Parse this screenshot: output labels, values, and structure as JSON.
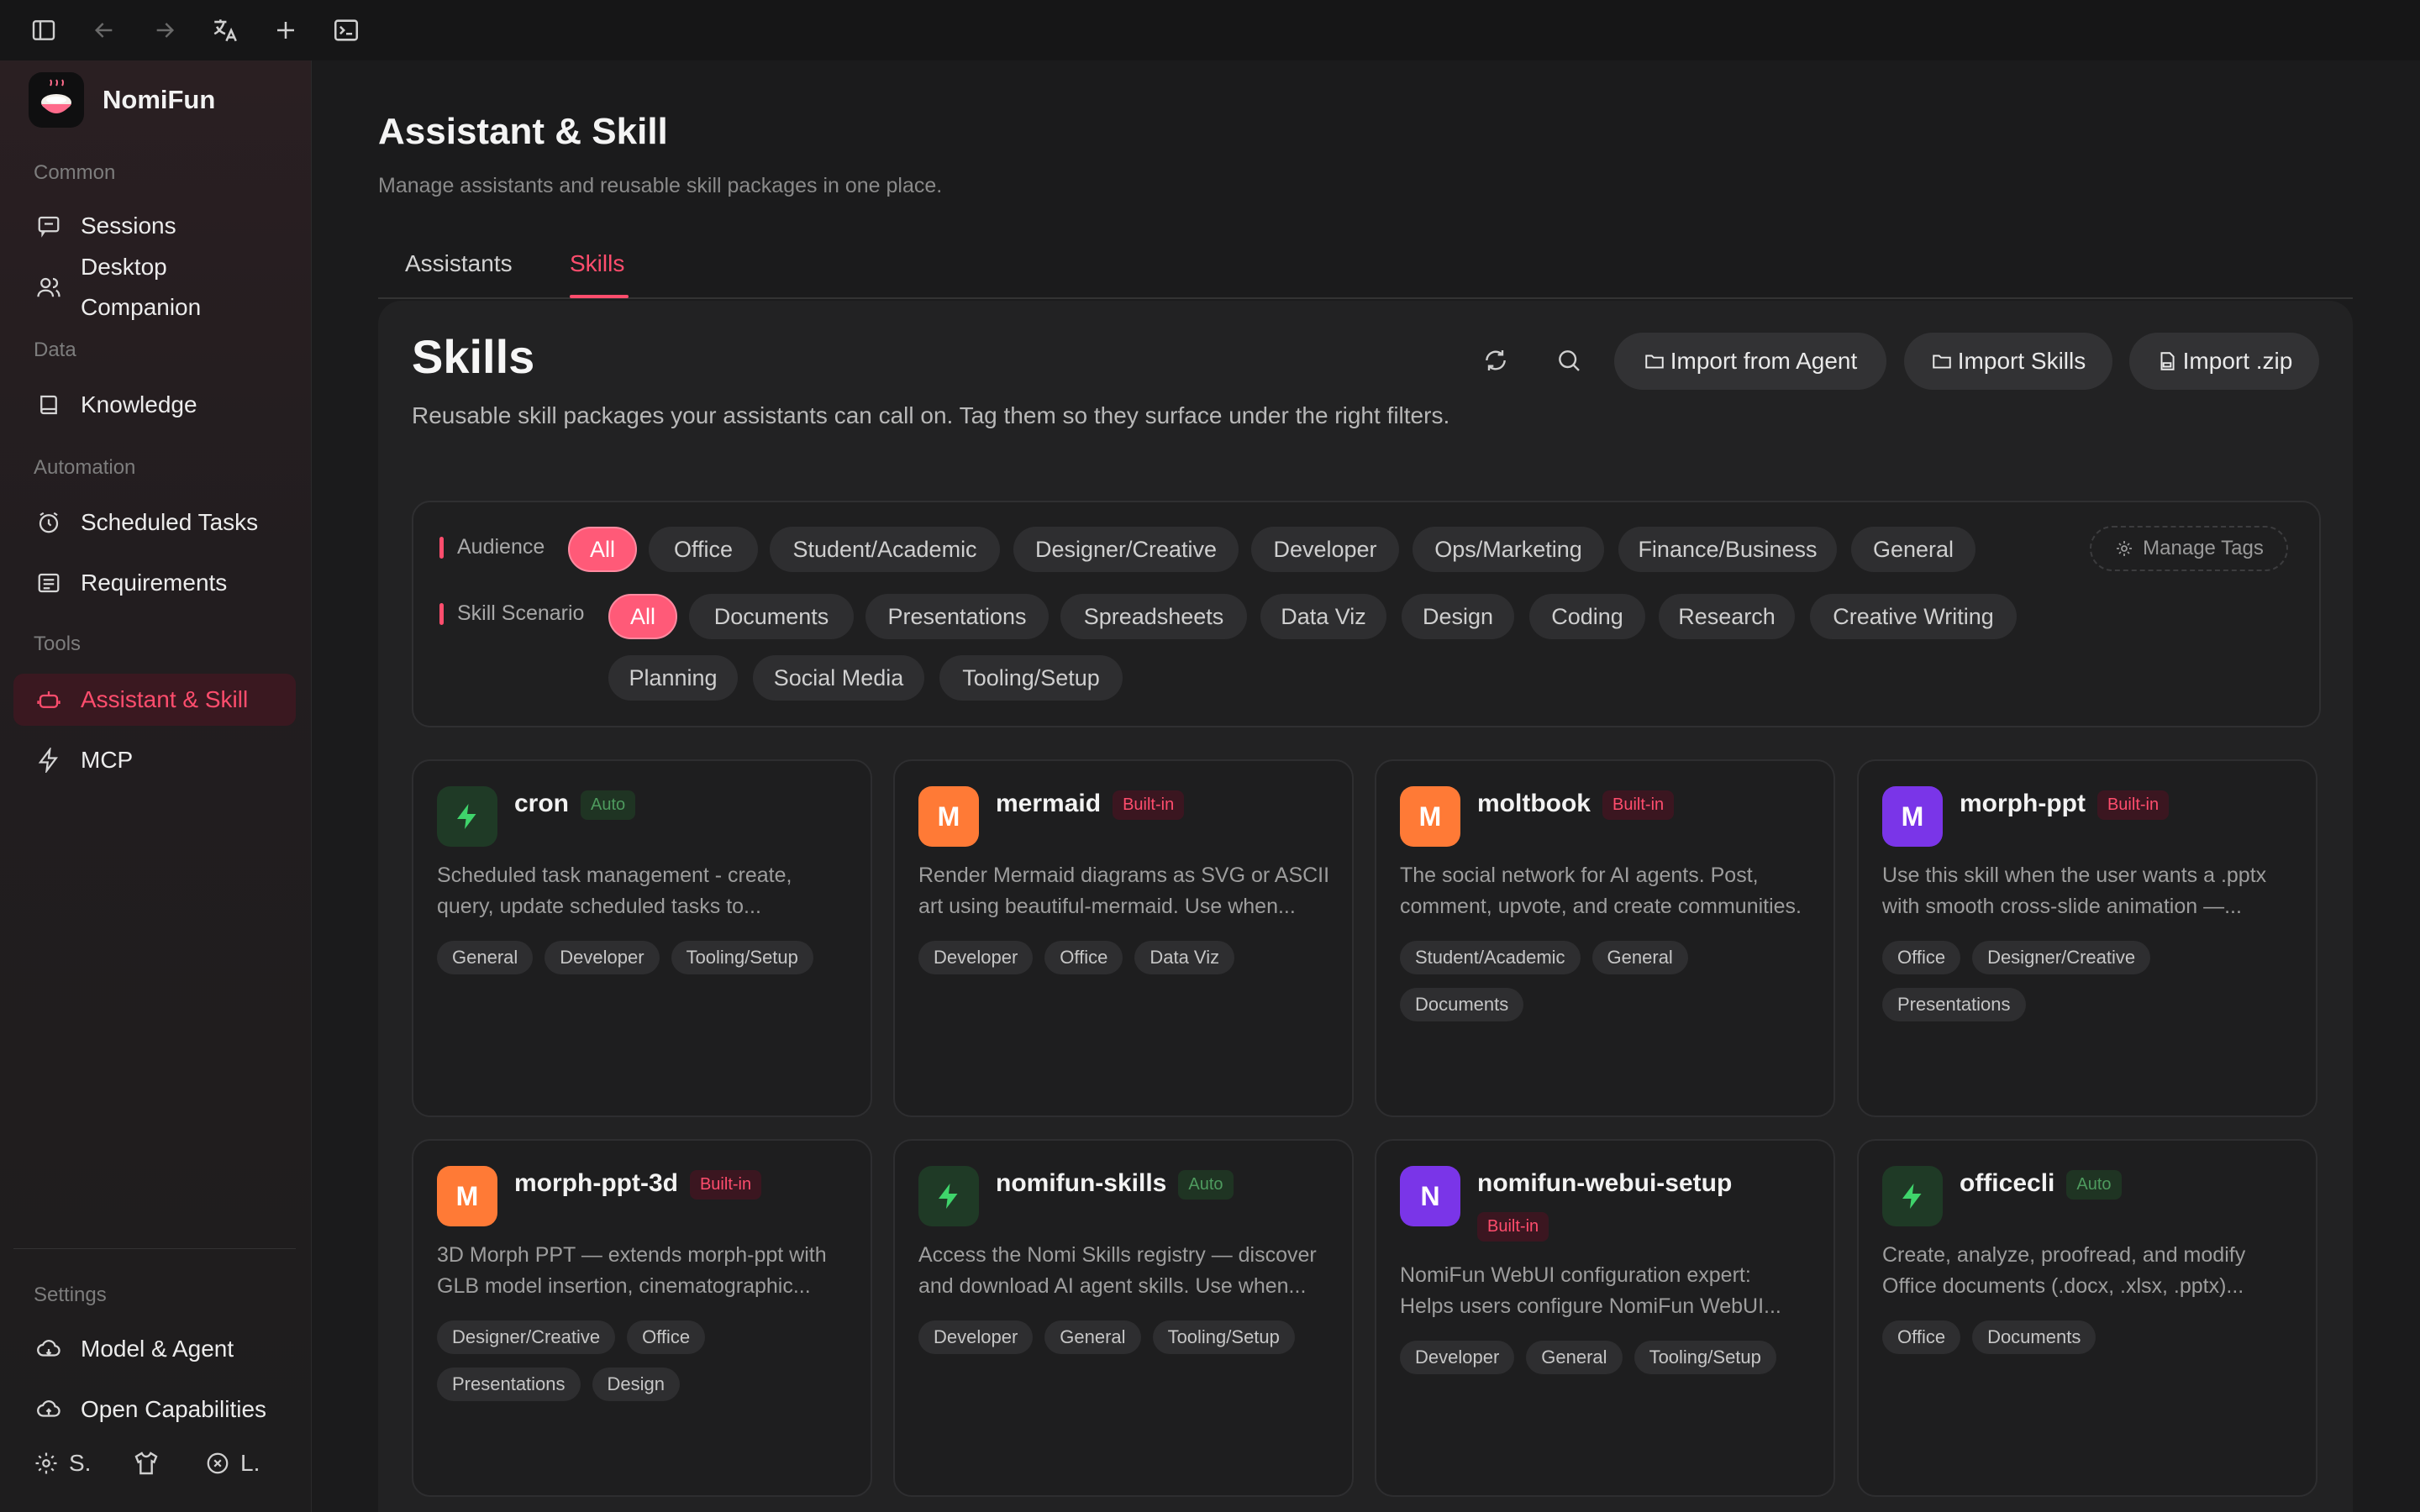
{
  "brand": {
    "name": "NomiFun"
  },
  "sidebar": {
    "sections": {
      "common": "Common",
      "data": "Data",
      "automation": "Automation",
      "tools": "Tools",
      "settings": "Settings"
    },
    "items": {
      "sessions": "Sessions",
      "desktop_companion_1": "Desktop",
      "desktop_companion_2": "Companion",
      "knowledge": "Knowledge",
      "scheduled_tasks": "Scheduled Tasks",
      "requirements": "Requirements",
      "assistant_skill": "Assistant & Skill",
      "mcp": "MCP",
      "model_agent": "Model & Agent",
      "open_capabilities": "Open Capabilities"
    },
    "footer": {
      "settings_short": "S.",
      "logout_short": "L."
    }
  },
  "page": {
    "title": "Assistant & Skill",
    "subtitle": "Manage assistants and reusable skill packages in one place.",
    "tabs": {
      "assistants": "Assistants",
      "skills": "Skills"
    }
  },
  "skills": {
    "heading": "Skills",
    "description": "Reusable skill packages your assistants can call on. Tag them so they surface under the right filters.",
    "buttons": {
      "import_agent": "Import from Agent",
      "import_skills": "Import Skills",
      "import_zip": "Import .zip"
    }
  },
  "filters": {
    "audience_label": "Audience",
    "audience": [
      "All",
      "Office",
      "Student/Academic",
      "Designer/Creative",
      "Developer",
      "Ops/Marketing",
      "Finance/Business",
      "General"
    ],
    "scenario_label": "Skill Scenario",
    "scenario": [
      "All",
      "Documents",
      "Presentations",
      "Spreadsheets",
      "Data Viz",
      "Design",
      "Coding",
      "Research",
      "Creative Writing",
      "Planning",
      "Social Media",
      "Tooling/Setup"
    ],
    "manage_tags": "Manage Tags"
  },
  "cards": [
    {
      "name": "cron",
      "badge": "Auto",
      "avatar": "",
      "color": "green",
      "desc1": "Scheduled task management - create,",
      "desc2": "query, update scheduled tasks to...",
      "tags": [
        "General",
        "Developer",
        "Tooling/Setup"
      ]
    },
    {
      "name": "mermaid",
      "badge": "Built-in",
      "avatar": "M",
      "color": "orange",
      "desc1": "Render Mermaid diagrams as SVG or ASCII",
      "desc2": "art using beautiful-mermaid. Use when...",
      "tags": [
        "Developer",
        "Office",
        "Data Viz"
      ]
    },
    {
      "name": "moltbook",
      "badge": "Built-in",
      "avatar": "M",
      "color": "orange",
      "desc1": "The social network for AI agents. Post,",
      "desc2": "comment, upvote, and create communities.",
      "tags": [
        "Student/Academic",
        "General",
        "Documents"
      ]
    },
    {
      "name": "morph-ppt",
      "badge": "Built-in",
      "avatar": "M",
      "color": "purple",
      "desc1": "Use this skill when the user wants a .pptx",
      "desc2": "with smooth cross-slide animation —...",
      "tags": [
        "Office",
        "Designer/Creative",
        "Presentations"
      ]
    },
    {
      "name": "morph-ppt-3d",
      "badge": "Built-in",
      "avatar": "M",
      "color": "orange",
      "desc1": "3D Morph PPT — extends morph-ppt with",
      "desc2": "GLB model insertion, cinematographic...",
      "tags": [
        "Designer/Creative",
        "Office",
        "Presentations",
        "Design"
      ]
    },
    {
      "name": "nomifun-skills",
      "badge": "Auto",
      "avatar": "",
      "color": "green",
      "desc1": "Access the Nomi Skills registry — discover",
      "desc2": "and download AI agent skills. Use when...",
      "tags": [
        "Developer",
        "General",
        "Tooling/Setup"
      ]
    },
    {
      "name": "nomifun-webui-setup",
      "badge": "Built-in",
      "avatar": "N",
      "color": "purple",
      "desc1": "NomiFun WebUI configuration expert:",
      "desc2": "Helps users configure NomiFun WebUI...",
      "tags": [
        "Developer",
        "General",
        "Tooling/Setup"
      ]
    },
    {
      "name": "officecli",
      "badge": "Auto",
      "avatar": "",
      "color": "green",
      "desc1": "Create, analyze, proofread, and modify",
      "desc2": "Office documents (.docx, .xlsx, .pptx)...",
      "tags": [
        "Office",
        "Documents"
      ]
    }
  ]
}
